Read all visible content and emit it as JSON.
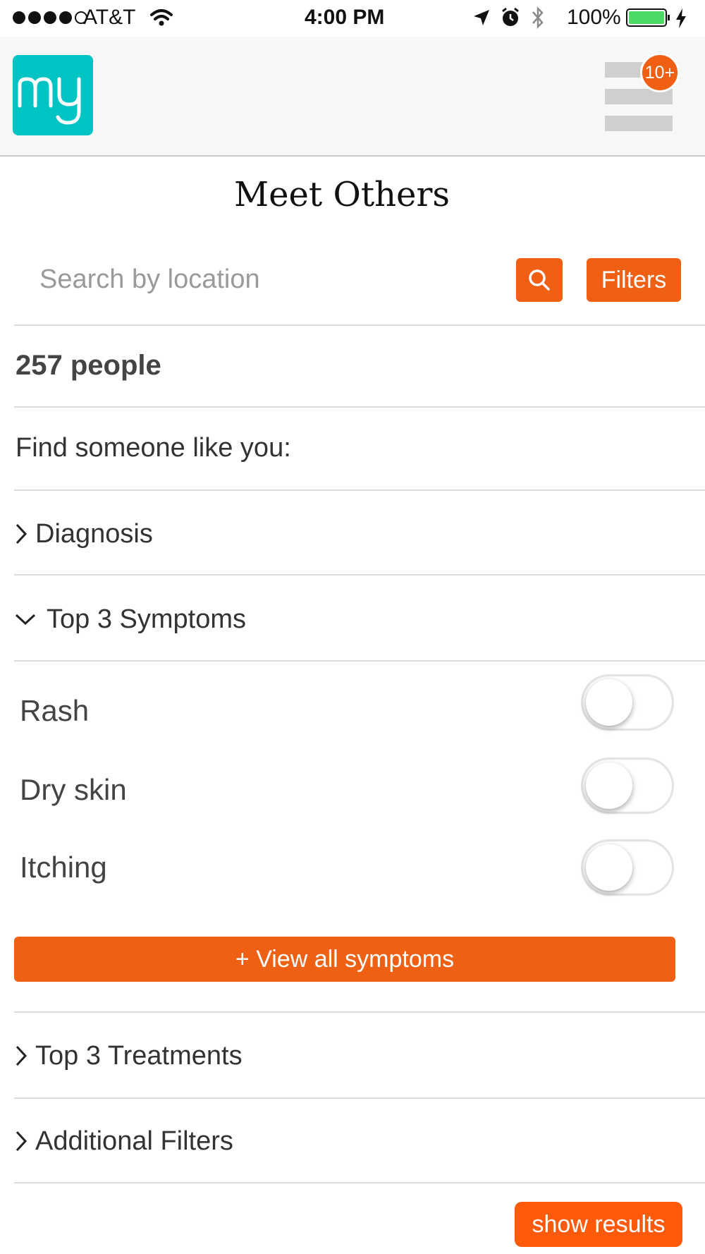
{
  "status_bar": {
    "carrier": "AT&T",
    "time": "4:00 PM",
    "battery": "100%"
  },
  "header": {
    "logo_text": "my",
    "notification_badge": "10+"
  },
  "page": {
    "title": "Meet Others"
  },
  "search": {
    "placeholder": "Search by location",
    "filters_label": "Filters"
  },
  "results": {
    "count_label": "257 people",
    "prompt": "Find someone like you:"
  },
  "sections": {
    "diagnosis": "Diagnosis",
    "symptoms": "Top 3 Symptoms",
    "treatments": "Top 3 Treatments",
    "additional": "Additional Filters"
  },
  "symptoms": [
    {
      "label": "Rash",
      "enabled": false
    },
    {
      "label": "Dry skin",
      "enabled": false
    },
    {
      "label": "Itching",
      "enabled": false
    }
  ],
  "actions": {
    "view_all": "+ View all symptoms",
    "show_results": "show results"
  },
  "colors": {
    "accent": "#f06014",
    "logo": "#00c3c3",
    "battery": "#4cd964"
  }
}
